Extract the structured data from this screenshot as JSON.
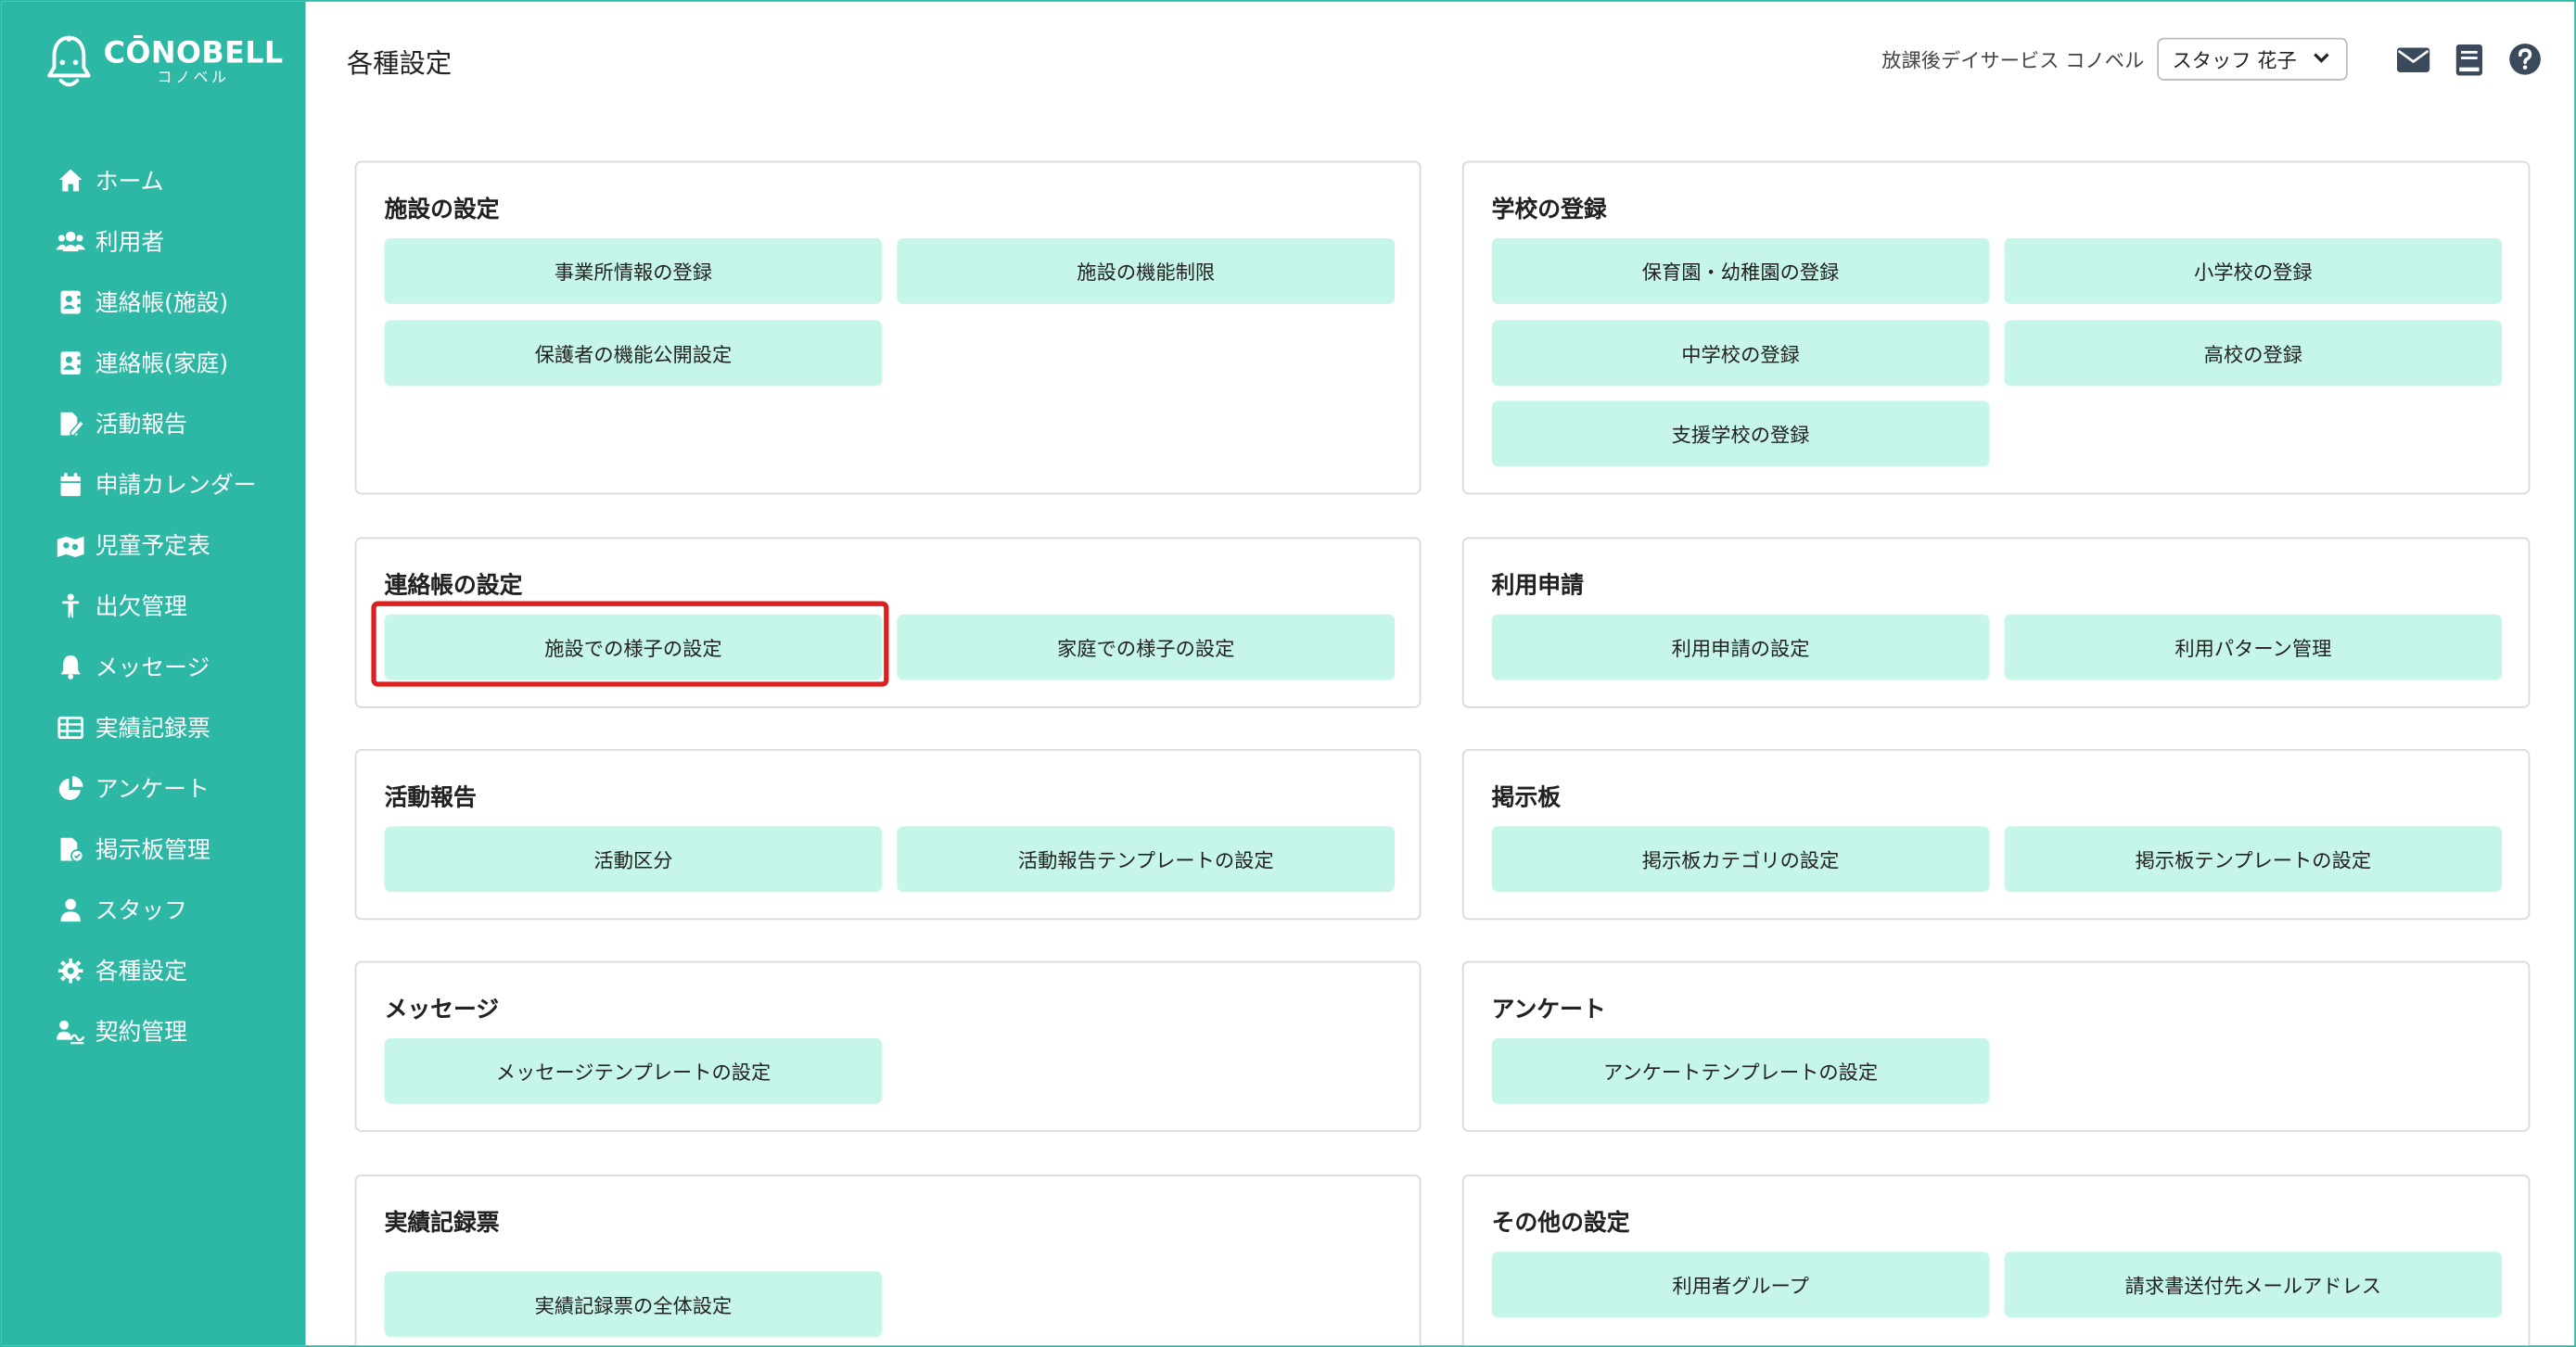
{
  "brand": {
    "name": "CŌNOBELL",
    "kana": "コノベル"
  },
  "sidebar": {
    "items": [
      {
        "label": "ホーム",
        "icon": "home-icon"
      },
      {
        "label": "利用者",
        "icon": "users-icon"
      },
      {
        "label": "連絡帳(施設)",
        "icon": "contact-book-icon"
      },
      {
        "label": "連絡帳(家庭)",
        "icon": "contact-book-icon"
      },
      {
        "label": "活動報告",
        "icon": "report-edit-icon"
      },
      {
        "label": "申請カレンダー",
        "icon": "calendar-icon"
      },
      {
        "label": "児童予定表",
        "icon": "schedule-icon"
      },
      {
        "label": "出欠管理",
        "icon": "person-icon"
      },
      {
        "label": "メッセージ",
        "icon": "bell-icon"
      },
      {
        "label": "実績記録票",
        "icon": "table-icon"
      },
      {
        "label": "アンケート",
        "icon": "pie-chart-icon"
      },
      {
        "label": "掲示板管理",
        "icon": "bulletin-icon"
      },
      {
        "label": "スタッフ",
        "icon": "staff-icon"
      },
      {
        "label": "各種設定",
        "icon": "gear-icon"
      },
      {
        "label": "契約管理",
        "icon": "contract-icon"
      }
    ]
  },
  "header": {
    "title": "各種設定",
    "facility_name": "放課後デイサービス コノベル",
    "user_select": "スタッフ 花子",
    "icons": [
      "mail-icon",
      "manual-book-icon",
      "help-icon"
    ]
  },
  "cards": {
    "facility": {
      "title": "施設の設定",
      "buttons": [
        "事業所情報の登録",
        "施設の機能制限",
        "保護者の機能公開設定"
      ]
    },
    "school": {
      "title": "学校の登録",
      "buttons": [
        "保育園・幼稚園の登録",
        "小学校の登録",
        "中学校の登録",
        "高校の登録",
        "支援学校の登録"
      ]
    },
    "contact_book": {
      "title": "連絡帳の設定",
      "buttons": [
        "施設での様子の設定",
        "家庭での様子の設定"
      ]
    },
    "usage_request": {
      "title": "利用申請",
      "buttons": [
        "利用申請の設定",
        "利用パターン管理"
      ]
    },
    "activity_report": {
      "title": "活動報告",
      "buttons": [
        "活動区分",
        "活動報告テンプレートの設定"
      ]
    },
    "bulletin": {
      "title": "掲示板",
      "buttons": [
        "掲示板カテゴリの設定",
        "掲示板テンプレートの設定"
      ]
    },
    "message": {
      "title": "メッセージ",
      "buttons": [
        "メッセージテンプレートの設定"
      ]
    },
    "survey": {
      "title": "アンケート",
      "buttons": [
        "アンケートテンプレートの設定"
      ]
    },
    "record": {
      "title": "実績記録票",
      "buttons": [
        "実績記録票の全体設定"
      ]
    },
    "other": {
      "title": "その他の設定",
      "buttons": [
        "利用者グループ",
        "請求書送付先メールアドレス"
      ]
    }
  },
  "colors": {
    "sidebar": "#2cb8a4",
    "tile": "#c6f5ea",
    "highlight": "#e01e1e"
  }
}
